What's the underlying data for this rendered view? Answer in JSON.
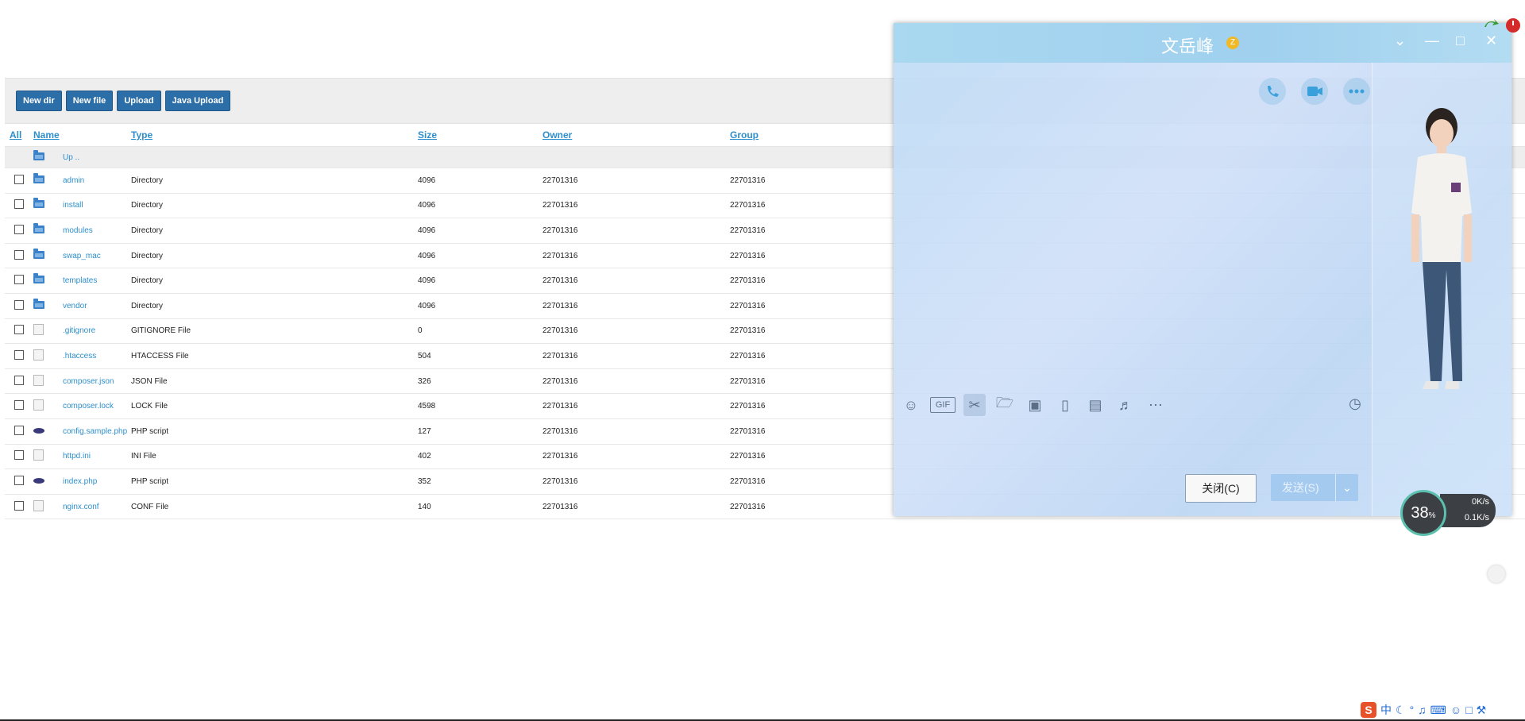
{
  "toolbar": {
    "buttons": [
      "New dir",
      "New file",
      "Upload",
      "Java Upload"
    ]
  },
  "columns": {
    "all": "All",
    "name": "Name",
    "type": "Type",
    "size": "Size",
    "owner": "Owner",
    "group": "Group"
  },
  "up_label": "Up ..",
  "rows": [
    {
      "name": "admin",
      "type": "Directory",
      "size": "4096",
      "owner": "22701316",
      "group": "22701316",
      "icon": "folder-icon"
    },
    {
      "name": "install",
      "type": "Directory",
      "size": "4096",
      "owner": "22701316",
      "group": "22701316",
      "icon": "folder-icon"
    },
    {
      "name": "modules",
      "type": "Directory",
      "size": "4096",
      "owner": "22701316",
      "group": "22701316",
      "icon": "folder-icon"
    },
    {
      "name": "swap_mac",
      "type": "Directory",
      "size": "4096",
      "owner": "22701316",
      "group": "22701316",
      "icon": "folder-icon"
    },
    {
      "name": "templates",
      "type": "Directory",
      "size": "4096",
      "owner": "22701316",
      "group": "22701316",
      "icon": "folder-icon"
    },
    {
      "name": "vendor",
      "type": "Directory",
      "size": "4096",
      "owner": "22701316",
      "group": "22701316",
      "icon": "folder-icon"
    },
    {
      "name": ".gitignore",
      "type": "GITIGNORE File",
      "size": "0",
      "owner": "22701316",
      "group": "22701316",
      "icon": "file-icon"
    },
    {
      "name": ".htaccess",
      "type": "HTACCESS File",
      "size": "504",
      "owner": "22701316",
      "group": "22701316",
      "icon": "file-icon"
    },
    {
      "name": "composer.json",
      "type": "JSON File",
      "size": "326",
      "owner": "22701316",
      "group": "22701316",
      "icon": "file-icon"
    },
    {
      "name": "composer.lock",
      "type": "LOCK File",
      "size": "4598",
      "owner": "22701316",
      "group": "22701316",
      "icon": "file-icon"
    },
    {
      "name": "config.sample.php",
      "type": "PHP script",
      "size": "127",
      "owner": "22701316",
      "group": "22701316",
      "icon": "php-icon"
    },
    {
      "name": "httpd.ini",
      "type": "INI File",
      "size": "402",
      "owner": "22701316",
      "group": "22701316",
      "icon": "file-icon"
    },
    {
      "name": "index.php",
      "type": "PHP script",
      "size": "352",
      "owner": "22701316",
      "group": "22701316",
      "icon": "php-icon"
    },
    {
      "name": "nginx.conf",
      "type": "CONF File",
      "size": "140",
      "owner": "22701316",
      "group": "22701316",
      "icon": "file-icon"
    }
  ],
  "chat": {
    "contact_name": "文岳峰",
    "crown_badge": "Z",
    "close_button": "关闭(C)",
    "send_button": "发送(S)",
    "tools": [
      "emoji-icon",
      "gif-icon",
      "scissors-icon",
      "folder-icon",
      "image-icon",
      "shake-icon",
      "red-packet-icon",
      "music-icon",
      "more-icon"
    ],
    "gif_label": "GIF"
  },
  "net_monitor": {
    "percent": "38",
    "percent_unit": "%",
    "upload": "0K/s",
    "download": "0.1K/s"
  },
  "ime": {
    "logo": "S",
    "mode": "中"
  }
}
